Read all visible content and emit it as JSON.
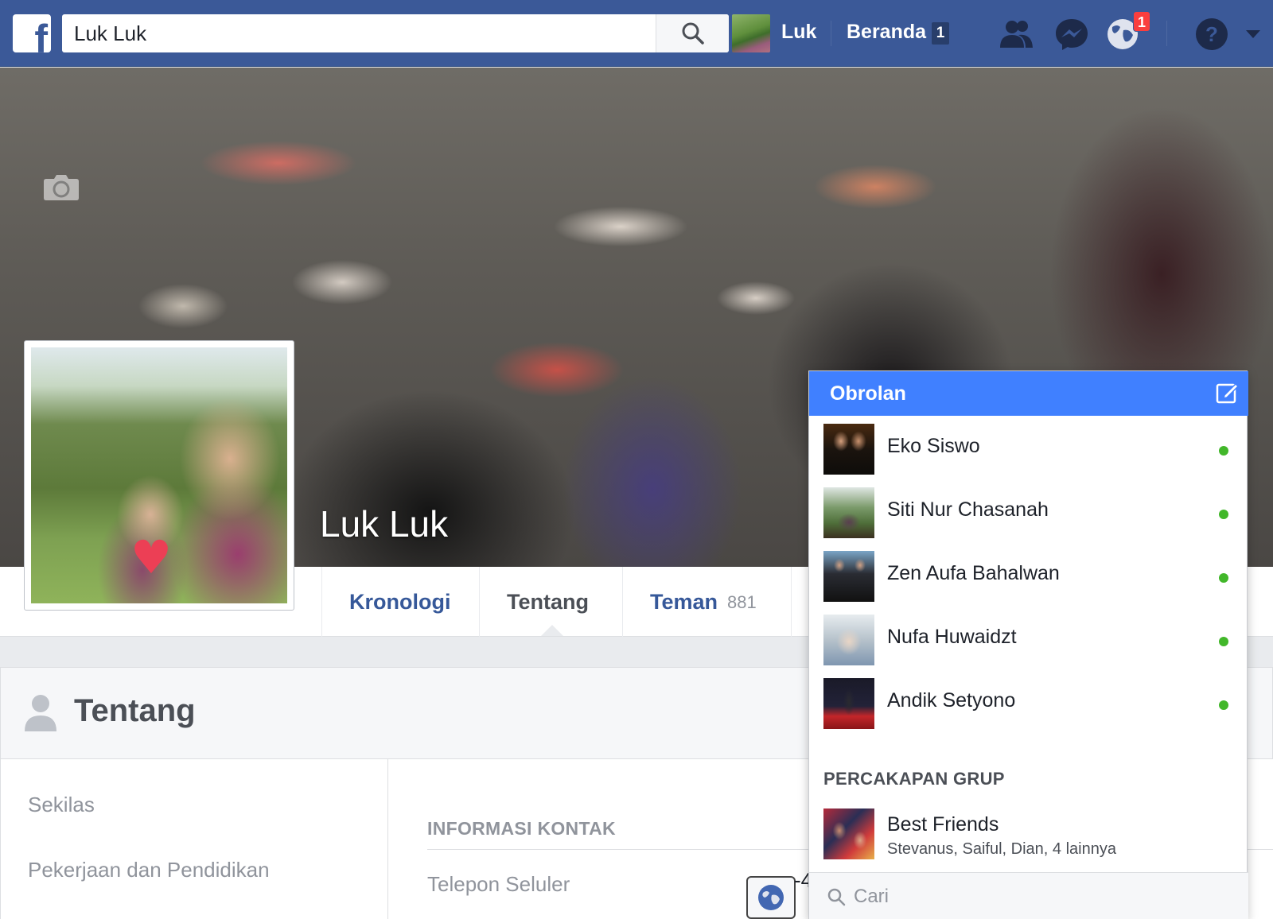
{
  "topbar": {
    "logo": "f",
    "search": {
      "value": "Luk Luk",
      "placeholder": ""
    },
    "user_name": "Luk",
    "home_label": "Beranda",
    "home_count": "1",
    "notification_count": "1",
    "icons": [
      "friend-requests-icon",
      "messenger-icon",
      "notifications-globe-icon",
      "help-icon",
      "dropdown-arrow-icon"
    ]
  },
  "profile": {
    "name": "Luk Luk",
    "tabs": [
      {
        "label": "Kronologi",
        "count": ""
      },
      {
        "label": "Tentang",
        "count": ""
      },
      {
        "label": "Teman",
        "count": "881"
      }
    ]
  },
  "about": {
    "title": "Tentang",
    "sidebar": [
      "Sekilas",
      "Pekerjaan dan Pendidikan"
    ],
    "section_heading": "INFORMASI KONTAK",
    "field_label": "Telepon Seluler",
    "field_value_fragment": "-4"
  },
  "chat": {
    "title": "Obrolan",
    "contacts": [
      {
        "name": "Eko Siswo",
        "online": true
      },
      {
        "name": "Siti Nur Chasanah",
        "online": true
      },
      {
        "name": "Zen Aufa Bahalwan",
        "online": true
      },
      {
        "name": "Nufa Huwaidzt",
        "online": true
      },
      {
        "name": "Andik Setyono",
        "online": true
      }
    ],
    "group_section": "PERCAKAPAN GRUP",
    "group": {
      "name": "Best Friends",
      "members": "Stevanus, Saiful, Dian, 4 lainnya"
    },
    "search_placeholder": "Cari"
  },
  "colors": {
    "topbar": "#3b5998",
    "chat_header": "#4080ff",
    "online": "#42b72a",
    "badge": "#fa3e3e",
    "link": "#365899"
  }
}
